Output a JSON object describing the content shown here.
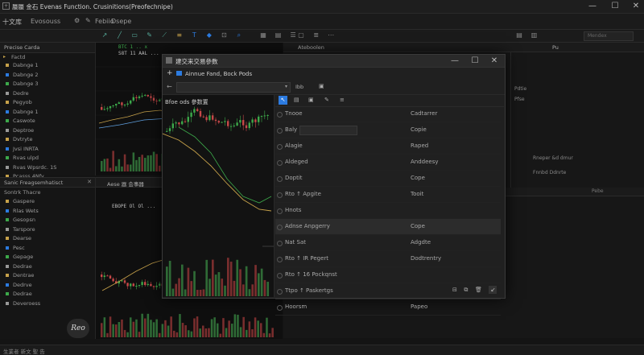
{
  "window": {
    "title": "蜃蜃 金石 Evenas Function. Crusinitions(Preofechnipe)",
    "minimize": "—",
    "maximize": "☐",
    "close": "✕"
  },
  "toolbar1": {
    "label1": "十文库",
    "label2": "Evosouss",
    "label3": "Febiio",
    "label4": "Dsepe"
  },
  "left_panel_top": {
    "title": "Precise Carda",
    "section": "Factd",
    "items": [
      "Dabnge 1",
      "Dabnge 2",
      "Dabnge 3",
      "Dedre",
      "Pegyob",
      "Dabnge 1",
      "Caswote",
      "Deptroe",
      "Dvtryte",
      "Jvsi INRTA",
      "Rvas ulpd",
      "Rvas Wpsrdc. 1S",
      "Pcasss 4Nfy",
      "Rlws J.N",
      "Pcazs S2N",
      "Dacs Lan/s"
    ]
  },
  "left_panel_bottom": {
    "title": "Sanic Freagsemhatisct",
    "subtitle": "Sontrk Thacre",
    "items": [
      "Gaspere",
      "Rlas Wets",
      "Gesopsn",
      "Tarspore",
      "Dearse",
      "Pesc",
      "Gepage",
      "Dedrae",
      "Dentrae",
      "Dedrve",
      "Dedrae",
      "Deveroess"
    ]
  },
  "chart_top": {
    "legend1": "BTC 1 .. x",
    "legend2": "S8T 11 AAL ..."
  },
  "chart_bottom": {
    "header": "Aese 器 会事器",
    "legend": "EBOPE Ol Ol ..."
  },
  "right_panel": {
    "tab": "Ateboolen",
    "col2": "Pu",
    "search_placeholder": "Mendex",
    "footer1": "Rneper &d dmur",
    "footer2": "Fnnbd Ddnrte",
    "empty_label": "Pebe",
    "side_lbl1": "Pdtie",
    "side_lbl2": "Pfse"
  },
  "dialog": {
    "title": "建交来交易參数",
    "path": "Ainnue Fand, Bock Pods",
    "subtitle": "Ibb",
    "chart_label": "Bfoe ods 參数置",
    "rows": [
      {
        "key": "Tnooe",
        "value": "Cadtarrer"
      },
      {
        "key": "Baly ↓ Tergd",
        "value": "Copie"
      },
      {
        "key": "Alagie",
        "value": "Raped"
      },
      {
        "key": "Aldeged",
        "value": "Anddeesy"
      },
      {
        "key": "Doptit",
        "value": "Cope"
      },
      {
        "key": "Rto ↑ Apgite",
        "value": "Tooit"
      },
      {
        "key": "Hnots",
        "value": ""
      },
      {
        "key": "Adnse Anpgerry",
        "value": "Cope"
      },
      {
        "key": "Nat Sat",
        "value": "Adgdte"
      },
      {
        "key": "Rto ↑ IR Pegert",
        "value": "Dodtrentry"
      },
      {
        "key": "Rto ↑ 16 Pockqnst",
        "value": ""
      },
      {
        "key": "Ttpo ↑ Paskertgs",
        "value": ""
      },
      {
        "key": "Hoorsm",
        "value": "Papeo"
      }
    ]
  },
  "bottom_left_logo": "Reo",
  "status_bar": {
    "text": "生業者 新文 聖 告"
  },
  "colors": {
    "accent": "#2c7be0",
    "up": "#3ca84a",
    "down": "#c64848",
    "gold": "#c7a24a"
  },
  "chart_data": [
    {
      "type": "line",
      "title": "",
      "series": [
        {
          "name": "",
          "values": [
            40,
            44,
            48,
            52,
            55,
            52,
            47,
            44,
            48,
            54,
            57,
            60,
            55,
            52,
            58,
            62,
            60,
            56,
            54,
            58
          ]
        }
      ]
    },
    {
      "type": "bar",
      "title": "",
      "values": [
        20,
        32,
        28,
        24,
        44,
        36,
        22,
        30,
        26,
        40,
        34,
        24,
        18,
        28,
        32,
        22
      ]
    }
  ]
}
